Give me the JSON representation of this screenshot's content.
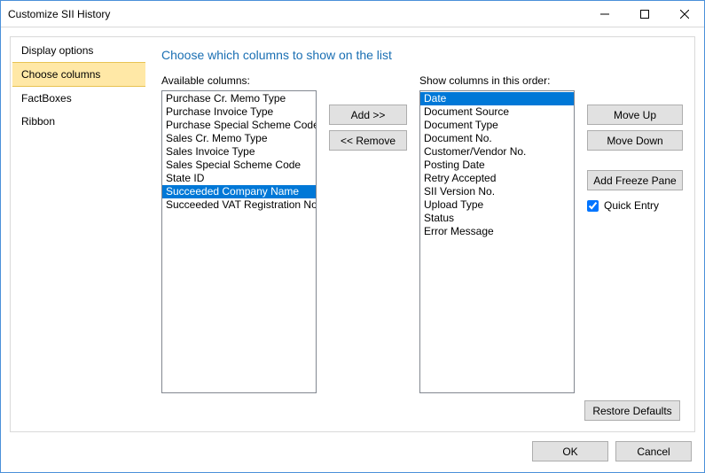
{
  "window": {
    "title": "Customize SII History"
  },
  "sidebar": {
    "items": [
      {
        "label": "Display options"
      },
      {
        "label": "Choose columns"
      },
      {
        "label": "FactBoxes"
      },
      {
        "label": "Ribbon"
      }
    ],
    "selected_index": 1
  },
  "content": {
    "heading": "Choose which columns to show on the list",
    "available_label": "Available columns:",
    "shown_label": "Show columns in this order:",
    "buttons": {
      "add": "Add >>",
      "remove": "<< Remove",
      "move_up": "Move Up",
      "move_down": "Move Down",
      "freeze": "Add Freeze Pane",
      "restore": "Restore Defaults"
    },
    "quick_entry_label": "Quick Entry",
    "quick_entry_checked": true,
    "available_columns": [
      "Purchase Cr. Memo Type",
      "Purchase Invoice Type",
      "Purchase Special Scheme Code",
      "Sales Cr. Memo Type",
      "Sales Invoice Type",
      "Sales Special Scheme Code",
      "State ID",
      "Succeeded Company Name",
      "Succeeded VAT Registration No."
    ],
    "available_selected_index": 7,
    "shown_columns": [
      "Date",
      "Document Source",
      "Document Type",
      "Document No.",
      "Customer/Vendor No.",
      "Posting Date",
      "Retry Accepted",
      "SII Version No.",
      "Upload Type",
      "Status",
      "Error Message"
    ],
    "shown_selected_index": 0
  },
  "dialog": {
    "ok": "OK",
    "cancel": "Cancel"
  }
}
